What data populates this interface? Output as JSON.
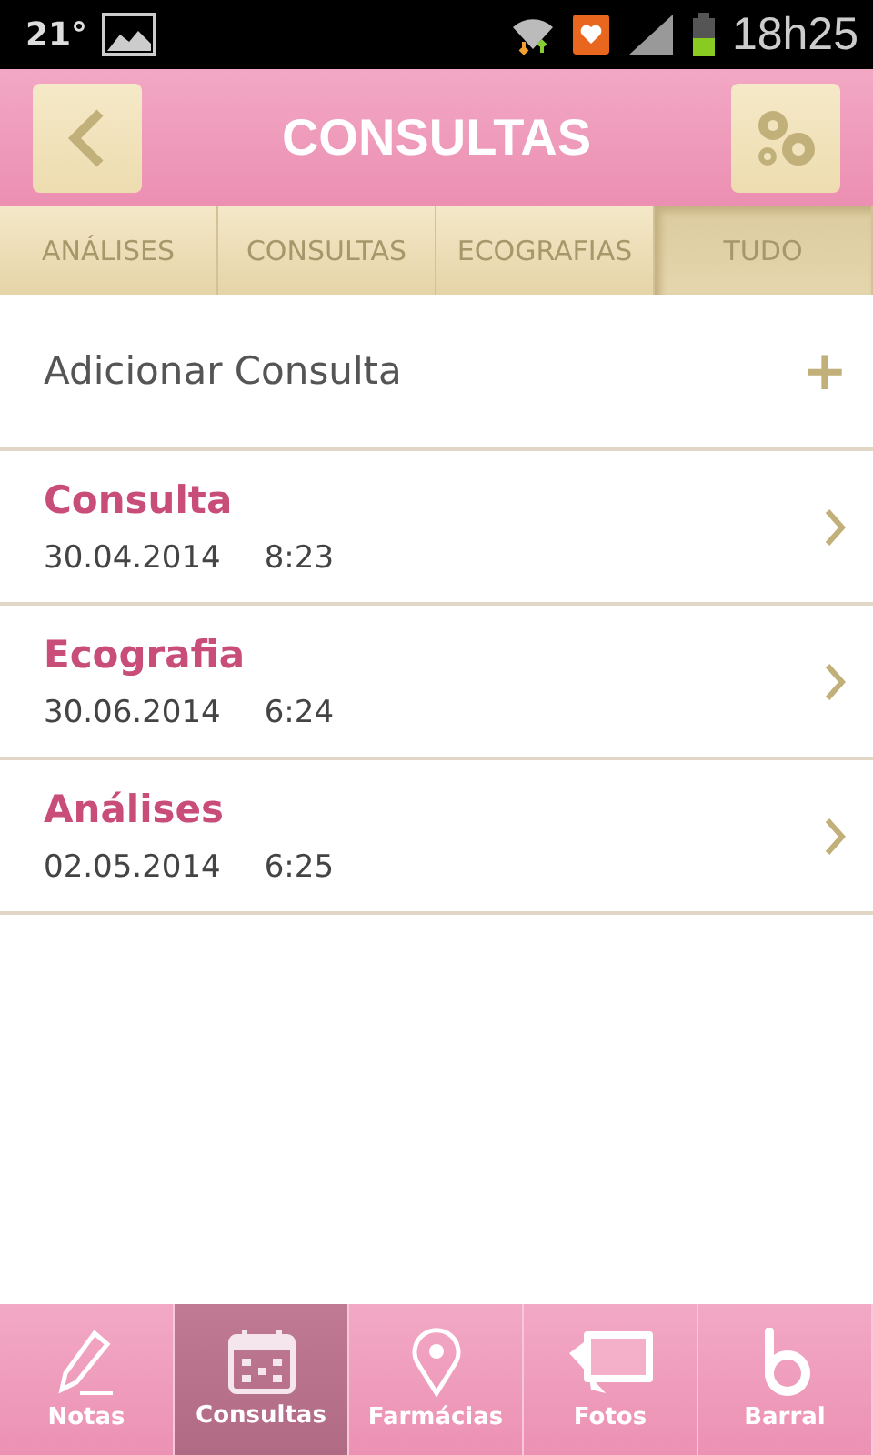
{
  "status_bar": {
    "temperature": "21°",
    "time": "18h25"
  },
  "header": {
    "title": "CONSULTAS"
  },
  "tabs": [
    {
      "label": "ANÁLISES",
      "selected": false
    },
    {
      "label": "CONSULTAS",
      "selected": false
    },
    {
      "label": "ECOGRAFIAS",
      "selected": false
    },
    {
      "label": "TUDO",
      "selected": true
    }
  ],
  "add_row": {
    "label": "Adicionar Consulta",
    "icon": "+"
  },
  "entries": [
    {
      "title": "Consulta",
      "date": "30.04.2014",
      "time": "8:23"
    },
    {
      "title": "Ecografia",
      "date": "30.06.2014",
      "time": "6:24"
    },
    {
      "title": "Análises",
      "date": "02.05.2014",
      "time": "6:25"
    }
  ],
  "bottom_nav": [
    {
      "label": "Notas",
      "kind": "pencil",
      "selected": false
    },
    {
      "label": "Consultas",
      "kind": "calendar",
      "selected": true
    },
    {
      "label": "Farmácias",
      "kind": "pin",
      "selected": false
    },
    {
      "label": "Fotos",
      "kind": "photos",
      "selected": false
    },
    {
      "label": "Barral",
      "kind": "logo",
      "selected": false
    }
  ]
}
